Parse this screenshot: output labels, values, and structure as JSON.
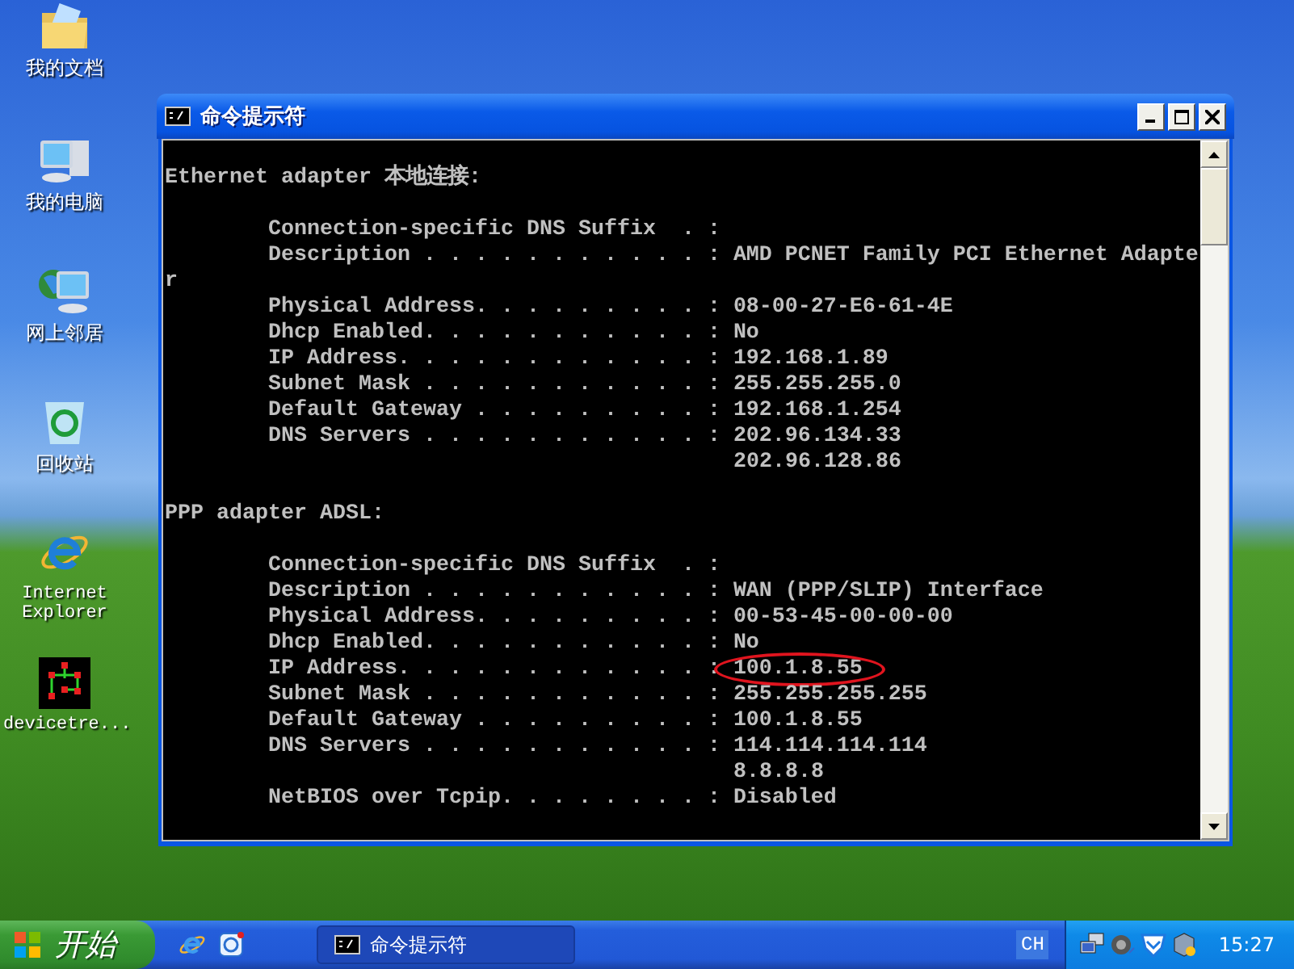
{
  "desktop_icons": [
    {
      "kind": "folder",
      "label": "我的文档"
    },
    {
      "kind": "computer",
      "label": "我的电脑"
    },
    {
      "kind": "network",
      "label": "网上邻居"
    },
    {
      "kind": "recycle",
      "label": "回收站"
    },
    {
      "kind": "browser",
      "label": "Internet Explorer"
    },
    {
      "kind": "app",
      "label": "devicetre..."
    }
  ],
  "window": {
    "title": "命令提示符",
    "lines": [
      {
        "kind": "header",
        "text": "Ethernet adapter 本地连接:"
      },
      {
        "kind": "blank"
      },
      {
        "kind": "field",
        "label": "Connection-specific DNS Suffix  . :",
        "circled": false
      },
      {
        "kind": "field",
        "label": "Description . . . . . . . . . . . :",
        "value": "AMD PCNET Family PCI Ethernet Adapte",
        "circled": false
      },
      {
        "kind": "wrap",
        "text": "r"
      },
      {
        "kind": "field",
        "label": "Physical Address. . . . . . . . . :",
        "value": "08-00-27-E6-61-4E",
        "circled": false
      },
      {
        "kind": "field",
        "label": "Dhcp Enabled. . . . . . . . . . . :",
        "value": "No",
        "circled": false
      },
      {
        "kind": "field",
        "label": "IP Address. . . . . . . . . . . . :",
        "value": "192.168.1.89",
        "circled": false
      },
      {
        "kind": "field",
        "label": "Subnet Mask . . . . . . . . . . . :",
        "value": "255.255.255.0",
        "circled": false
      },
      {
        "kind": "field",
        "label": "Default Gateway . . . . . . . . . :",
        "value": "192.168.1.254",
        "circled": false
      },
      {
        "kind": "field",
        "label": "DNS Servers . . . . . . . . . . . :",
        "value": "202.96.134.33",
        "circled": false
      },
      {
        "kind": "continuation",
        "value": "202.96.128.86"
      },
      {
        "kind": "blank"
      },
      {
        "kind": "header",
        "text": "PPP adapter ADSL:"
      },
      {
        "kind": "blank"
      },
      {
        "kind": "field",
        "label": "Connection-specific DNS Suffix  . :",
        "circled": false
      },
      {
        "kind": "field",
        "label": "Description . . . . . . . . . . . :",
        "value": "WAN (PPP/SLIP) Interface",
        "circled": false
      },
      {
        "kind": "field",
        "label": "Physical Address. . . . . . . . . :",
        "value": "00-53-45-00-00-00",
        "circled": false
      },
      {
        "kind": "field",
        "label": "Dhcp Enabled. . . . . . . . . . . :",
        "value": "No",
        "circled": false
      },
      {
        "kind": "field",
        "label": "IP Address. . . . . . . . . . . . :",
        "value": "100.1.8.55",
        "circled": true
      },
      {
        "kind": "field",
        "label": "Subnet Mask . . . . . . . . . . . :",
        "value": "255.255.255.255",
        "circled": false
      },
      {
        "kind": "field",
        "label": "Default Gateway . . . . . . . . . :",
        "value": "100.1.8.55",
        "circled": false
      },
      {
        "kind": "field",
        "label": "DNS Servers . . . . . . . . . . . :",
        "value": "114.114.114.114",
        "circled": false
      },
      {
        "kind": "continuation",
        "value": "8.8.8.8"
      },
      {
        "kind": "field",
        "label": "NetBIOS over Tcpip. . . . . . . . :",
        "value": "Disabled",
        "circled": false
      }
    ]
  },
  "taskbar": {
    "start_label": "开始",
    "tasks": [
      {
        "title": "命令提示符",
        "selected": true
      }
    ],
    "language": "CH",
    "clock": "15:27"
  }
}
